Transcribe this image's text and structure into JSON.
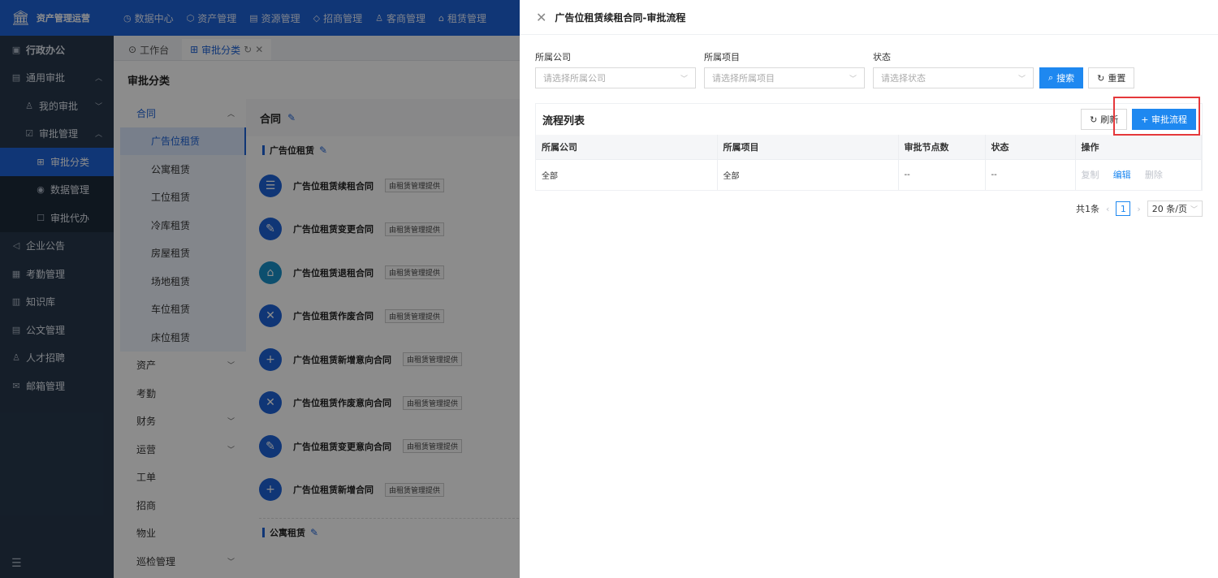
{
  "app": {
    "logo_text": "资产管理运营"
  },
  "topnav": [
    {
      "icon": "◷",
      "label": "数据中心"
    },
    {
      "icon": "⬡",
      "label": "资产管理"
    },
    {
      "icon": "▤",
      "label": "资源管理"
    },
    {
      "icon": "◇",
      "label": "招商管理"
    },
    {
      "icon": "♙",
      "label": "客商管理"
    },
    {
      "icon": "⌂",
      "label": "租赁管理"
    }
  ],
  "sidebar": [
    {
      "icon": "▣",
      "label": "行政办公"
    },
    {
      "icon": "▤",
      "label": "通用审批"
    },
    {
      "icon": "♙",
      "label": "我的审批"
    },
    {
      "icon": "☑",
      "label": "审批管理"
    },
    {
      "icon": "⊞",
      "label": "审批分类"
    },
    {
      "icon": "◉",
      "label": "数据管理"
    },
    {
      "icon": "☐",
      "label": "审批代办"
    },
    {
      "icon": "◁",
      "label": "企业公告"
    },
    {
      "icon": "▦",
      "label": "考勤管理"
    },
    {
      "icon": "▥",
      "label": "知识库"
    },
    {
      "icon": "▤",
      "label": "公文管理"
    },
    {
      "icon": "♙",
      "label": "人才招聘"
    },
    {
      "icon": "✉",
      "label": "邮箱管理"
    }
  ],
  "tabs": [
    {
      "icon": "⊙",
      "label": "工作台"
    },
    {
      "icon": "⊞",
      "label": "审批分类"
    }
  ],
  "content": {
    "title": "审批分类",
    "categories": [
      {
        "label": "合同"
      },
      {
        "label": "广告位租赁"
      },
      {
        "label": "公寓租赁"
      },
      {
        "label": "工位租赁"
      },
      {
        "label": "冷库租赁"
      },
      {
        "label": "房屋租赁"
      },
      {
        "label": "场地租赁"
      },
      {
        "label": "车位租赁"
      },
      {
        "label": "床位租赁"
      },
      {
        "label": "资产"
      },
      {
        "label": "考勤"
      },
      {
        "label": "财务"
      },
      {
        "label": "运营"
      },
      {
        "label": "工单"
      },
      {
        "label": "招商"
      },
      {
        "label": "物业"
      },
      {
        "label": "巡检管理"
      }
    ],
    "detail_title": "合同",
    "section1": "广告位租赁",
    "section2": "公寓租赁",
    "flows": [
      {
        "name": "广告位租赁续租合同",
        "tag": "由租赁管理提供"
      },
      {
        "name": "广告位租赁变更合同",
        "tag": "由租赁管理提供"
      },
      {
        "name": "广告位租赁退租合同",
        "tag": "由租赁管理提供"
      },
      {
        "name": "广告位租赁作废合同",
        "tag": "由租赁管理提供"
      },
      {
        "name": "广告位租赁新增意向合同",
        "tag": "由租赁管理提供"
      },
      {
        "name": "广告位租赁作废意向合同",
        "tag": "由租赁管理提供"
      },
      {
        "name": "广告位租赁变更意向合同",
        "tag": "由租赁管理提供"
      },
      {
        "name": "广告位租赁新增合同",
        "tag": "由租赁管理提供"
      }
    ]
  },
  "drawer": {
    "title": "广告位租赁续租合同-审批流程",
    "filters": [
      {
        "label": "所属公司",
        "placeholder": "请选择所属公司"
      },
      {
        "label": "所属项目",
        "placeholder": "请选择所属项目"
      },
      {
        "label": "状态",
        "placeholder": "请选择状态"
      }
    ],
    "search_label": "搜索",
    "reset_label": "重置",
    "list_title": "流程列表",
    "refresh_label": "刷新",
    "add_label": "+ 审批流程",
    "columns": [
      "所属公司",
      "所属项目",
      "审批节点数",
      "状态",
      "操作"
    ],
    "rows": [
      {
        "company": "全部",
        "project": "全部",
        "nodes": "--",
        "status": "--"
      }
    ],
    "ops": {
      "copy": "复制",
      "edit": "编辑",
      "delete": "删除"
    },
    "pager": {
      "total": "共1条",
      "page": "1",
      "size": "20 条/页"
    }
  }
}
